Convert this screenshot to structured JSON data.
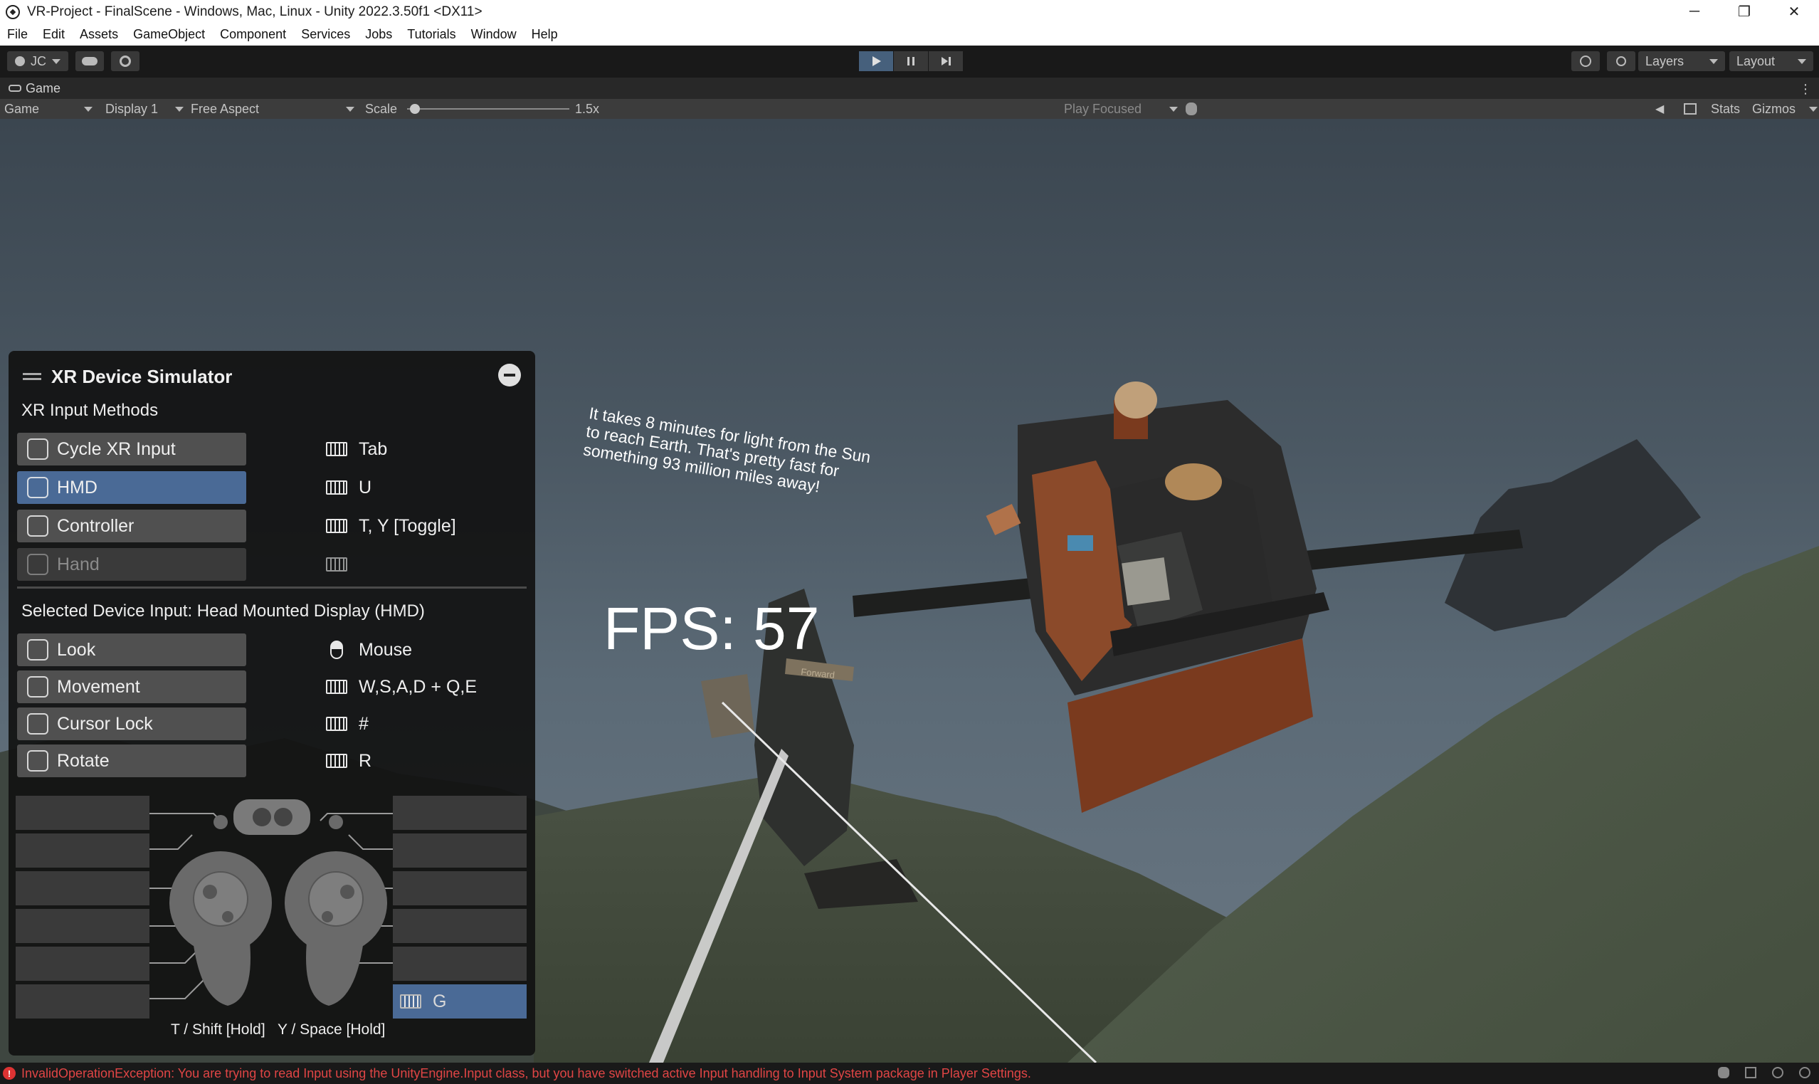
{
  "window": {
    "title": "VR-Project - FinalScene - Windows, Mac, Linux - Unity 2022.3.50f1 <DX11>",
    "controls": [
      "─",
      "❐",
      "✕"
    ]
  },
  "menu": [
    "File",
    "Edit",
    "Assets",
    "GameObject",
    "Component",
    "Services",
    "Jobs",
    "Tutorials",
    "Window",
    "Help"
  ],
  "toolbar": {
    "account": "JC",
    "layers": "Layers",
    "layout": "Layout"
  },
  "game_tab": {
    "title": "Game",
    "view_mode": "Game",
    "display": "Display 1",
    "aspect": "Free Aspect",
    "scale_label": "Scale",
    "scale_value": "1.5x",
    "scale_fraction": 0.02,
    "play_mode": "Play Focused",
    "stats": "Stats",
    "gizmos": "Gizmos"
  },
  "scene": {
    "fps": "FPS: 57",
    "fact": "It takes 8 minutes for light from the Sun to reach Earth. That's pretty fast for something 93 million miles away!",
    "sign": "Forward"
  },
  "xr": {
    "title": "XR Device Simulator",
    "methods_label": "XR Input Methods",
    "methods": [
      {
        "label": "Cycle XR Input",
        "key": "Tab",
        "icon": "cycle-icon"
      },
      {
        "label": "HMD",
        "key": "U",
        "icon": "hmd-icon"
      },
      {
        "label": "Controller",
        "key": "T, Y [Toggle]",
        "icon": "controller-icon"
      },
      {
        "label": "Hand",
        "key": "",
        "icon": "hand-icon"
      }
    ],
    "selected_label": "Selected Device Input: Head Mounted Display (HMD)",
    "inputs": [
      {
        "label": "Look",
        "key": "Mouse",
        "icon": "move-icon"
      },
      {
        "label": "Movement",
        "key": "W,S,A,D + Q,E",
        "icon": "dpad-icon"
      },
      {
        "label": "Cursor Lock",
        "key": "#",
        "icon": "cursor-icon"
      },
      {
        "label": "Rotate",
        "key": "R",
        "icon": "rotate-icon"
      }
    ],
    "right_active_key": "G",
    "hint_left": "T / Shift [Hold]",
    "hint_right": "Y / Space [Hold]"
  },
  "status": {
    "error": "InvalidOperationException: You are trying to read Input using the UnityEngine.Input class, but you have switched active Input handling to Input System package in Player Settings."
  },
  "colors": {
    "accent": "#4a6a96",
    "error": "#e04545"
  }
}
